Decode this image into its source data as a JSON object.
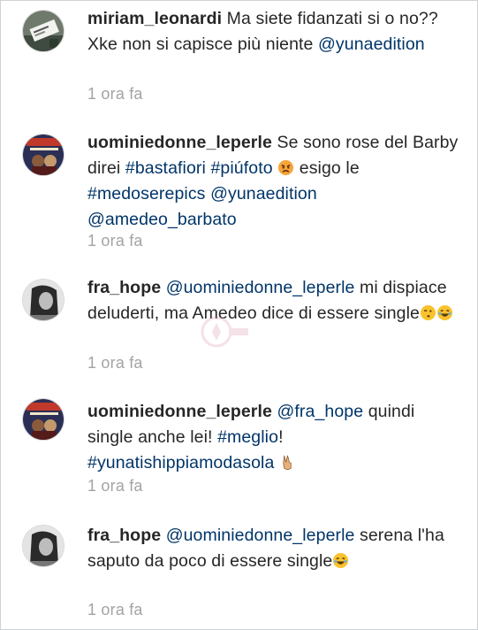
{
  "comments": [
    {
      "username": "miriam_leonardi",
      "segments": [
        "Ma siete fidanzati si o no?? Xke non si capisce più niente ",
        "@yunaedition"
      ],
      "time": "1 ora fa",
      "avatar_icon": "receipt-photo-avatar"
    },
    {
      "username": "uominiedonne_leperle",
      "segments": [
        "Se sono rose del Barby direi ",
        "#bastafiori",
        " ",
        "#piúfoto",
        " ",
        "esigo le ",
        "#medoserepics",
        " ",
        "@yunaedition",
        " ",
        "@amedeo_barbato"
      ],
      "time": "1 ora fa",
      "avatar_icon": "magazine-cover-avatar",
      "emoji": "angry-face-emoji"
    },
    {
      "username": "fra_hope",
      "segments": [
        "@uominiedonne_leperle",
        " mi dispiace deluderti, ma Amedeo dice di essere single"
      ],
      "time": "1 ora fa",
      "avatar_icon": "bw-portrait-avatar",
      "emoji": [
        "kissing-face-emoji",
        "laughing-face-emoji"
      ]
    },
    {
      "username": "uominiedonne_leperle",
      "segments": [
        "@fra_hope",
        " quindi single anche lei! ",
        "#meglio",
        "! ",
        "#yunatishippiamodasola"
      ],
      "time": "1 ora fa",
      "avatar_icon": "magazine-cover-avatar",
      "emoji": "victory-hand-emoji"
    },
    {
      "username": "fra_hope",
      "segments": [
        "@uominiedonne_leperle",
        " serena l'ha saputo da poco di essere single"
      ],
      "time": "1 ora fa",
      "avatar_icon": "bw-portrait-avatar",
      "emoji": "laughing-face-emoji"
    }
  ],
  "colors": {
    "text": "#262626",
    "link": "#003569",
    "timestamp": "#a3a3a3",
    "border": "#cfd3d6"
  }
}
